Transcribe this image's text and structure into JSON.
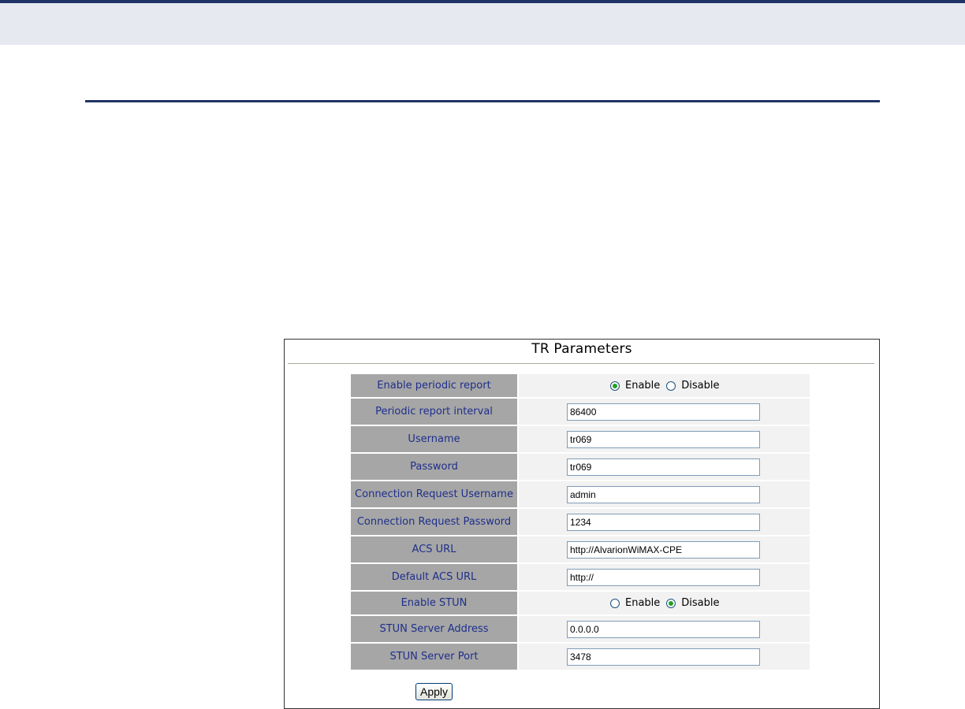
{
  "panel": {
    "title": "TR Parameters"
  },
  "rows": [
    {
      "label": "Enable periodic report",
      "type": "radio",
      "options": [
        "Enable",
        "Disable"
      ],
      "selected": "Enable"
    },
    {
      "label": "Periodic report interval",
      "type": "text",
      "value": "86400"
    },
    {
      "label": "Username",
      "type": "text",
      "value": "tr069"
    },
    {
      "label": "Password",
      "type": "text",
      "value": "tr069"
    },
    {
      "label": "Connection Request Username",
      "type": "text",
      "value": "admin"
    },
    {
      "label": "Connection Request Password",
      "type": "text",
      "value": "1234"
    },
    {
      "label": "ACS URL",
      "type": "text",
      "value": "http://AlvarionWiMAX-CPE"
    },
    {
      "label": "Default ACS URL",
      "type": "text",
      "value": "http://"
    },
    {
      "label": "Enable STUN",
      "type": "radio",
      "options": [
        "Enable",
        "Disable"
      ],
      "selected": "Disable"
    },
    {
      "label": "STUN Server Address",
      "type": "text",
      "value": "0.0.0.0"
    },
    {
      "label": "STUN Server Port",
      "type": "text",
      "value": "3478"
    }
  ],
  "apply_label": "Apply",
  "colors": {
    "header_accent": "#1f3466",
    "label_bg": "#a6a6a6",
    "label_text": "#1f2f8c",
    "value_bg": "#f2f2f2",
    "radio_checked": "#21a121"
  }
}
